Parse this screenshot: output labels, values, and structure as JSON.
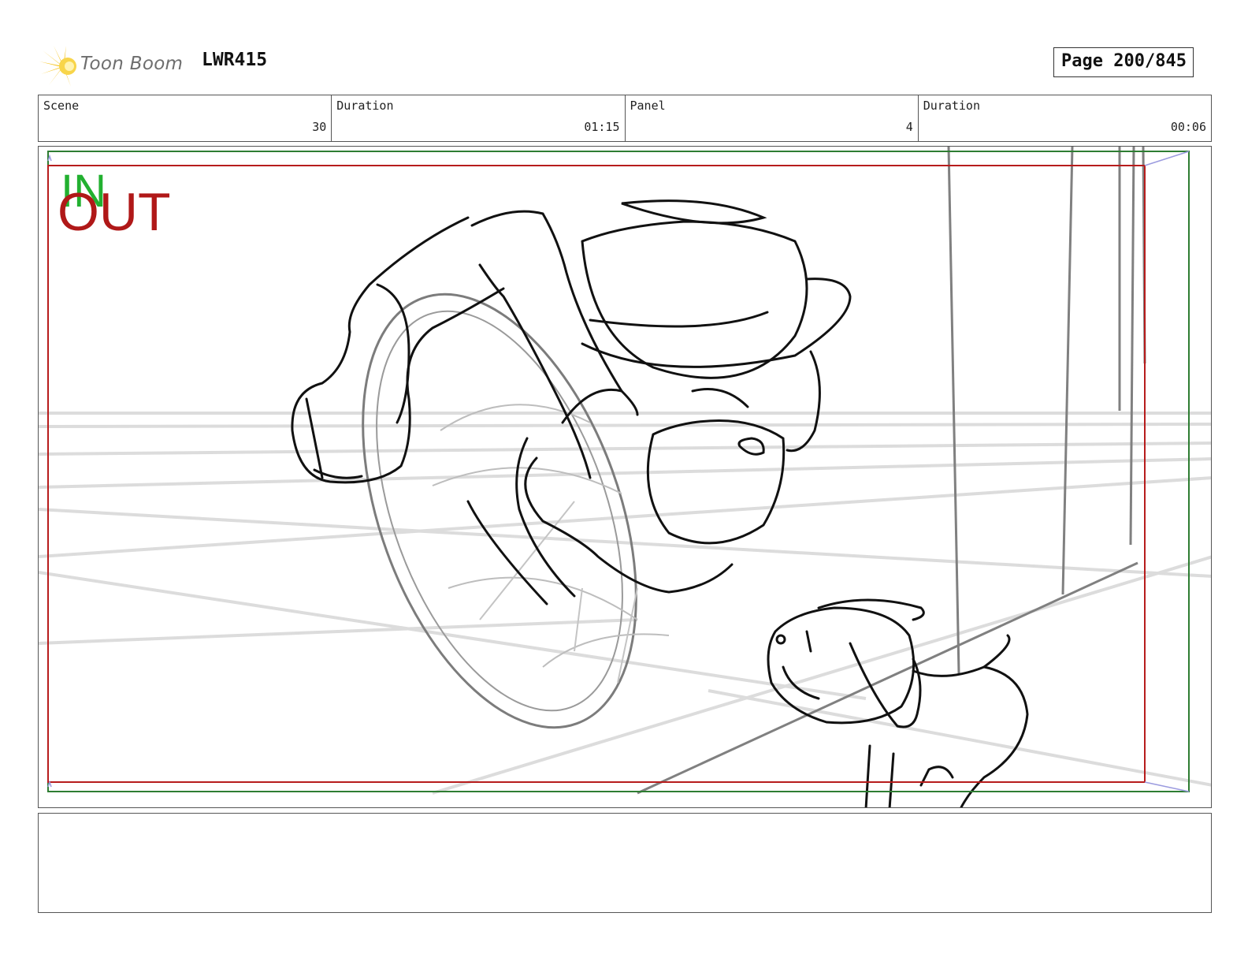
{
  "header": {
    "logo_text": "Toon Boom",
    "project_code": "LWR415",
    "page": "Page 200/845"
  },
  "info": [
    {
      "label": "Scene",
      "value": "30"
    },
    {
      "label": "Duration",
      "value": "01:15"
    },
    {
      "label": "Panel",
      "value": "4"
    },
    {
      "label": "Duration",
      "value": "00:06"
    }
  ],
  "panel": {
    "in_label": "IN",
    "out_label": "OUT"
  },
  "notes": {
    "text": ""
  },
  "colors": {
    "in_frame": "#2e7d32",
    "out_frame": "#b71c1c",
    "logo_accent": "#f6c31b"
  }
}
